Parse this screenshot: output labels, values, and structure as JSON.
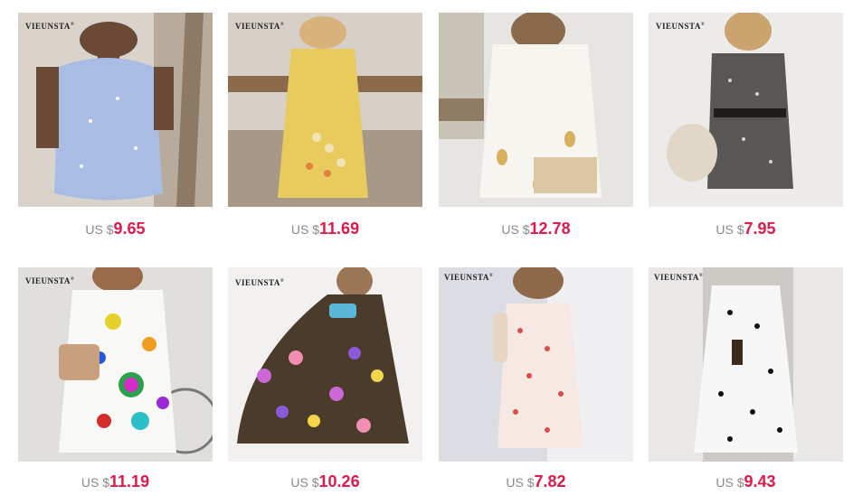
{
  "products": [
    {
      "brand": "VIEUNSTA",
      "currency": "US $",
      "price": "9.65",
      "dress": "blue floral slip dress"
    },
    {
      "brand": "VIEUNSTA",
      "currency": "US $",
      "price": "11.69",
      "dress": "yellow floral maxi dress"
    },
    {
      "brand": "",
      "currency": "US $",
      "price": "12.78",
      "dress": "white pineapple print dress"
    },
    {
      "brand": "VIEUNSTA",
      "currency": "US $",
      "price": "7.95",
      "dress": "grey floral belted dress"
    },
    {
      "brand": "VIEUNSTA",
      "currency": "US $",
      "price": "11.19",
      "dress": "white dress with colorful dots"
    },
    {
      "brand": "VIEUNSTA",
      "currency": "US $",
      "price": "10.26",
      "dress": "dark dress with flower print"
    },
    {
      "brand": "VIEUNSTA",
      "currency": "US $",
      "price": "7.82",
      "dress": "pink floral lace slip dress"
    },
    {
      "brand": "VIEUNSTA",
      "currency": "US $",
      "price": "9.43",
      "dress": "polka dot slip dress"
    }
  ]
}
